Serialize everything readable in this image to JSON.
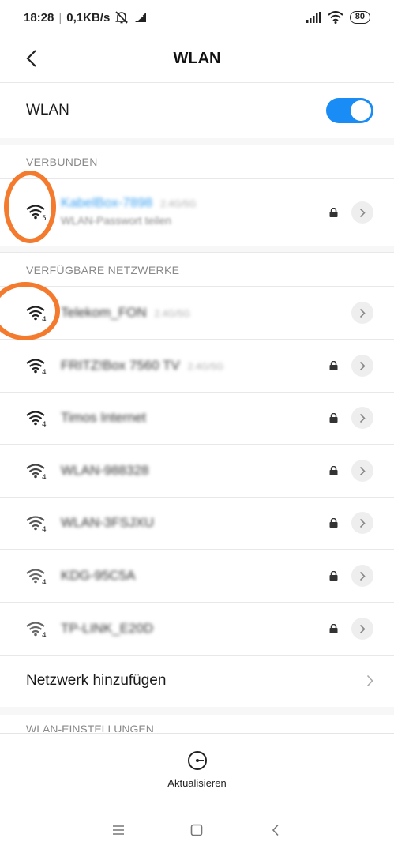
{
  "status_bar": {
    "time": "18:28",
    "network_speed": "0,1KB/s",
    "battery": "80"
  },
  "header": {
    "title": "WLAN"
  },
  "wlan_toggle": {
    "label": "WLAN",
    "enabled": true
  },
  "connected_section": {
    "header": "VERBUNDEN",
    "network": {
      "name": "KabelBox-7898",
      "band": "2.4G/5G",
      "subtitle": "WLAN-Passwort teilen",
      "signal": "5",
      "secured": true
    }
  },
  "available_section": {
    "header": "VERFÜGBARE NETZWERKE",
    "networks": [
      {
        "name": "Telekom_FON",
        "band": "2.4G/5G",
        "signal": "4",
        "secured": false
      },
      {
        "name": "FRITZ!Box 7560 TV",
        "band": "2.4G/5G",
        "signal": "4",
        "secured": true
      },
      {
        "name": "Timos Internet",
        "band": "",
        "signal": "4",
        "secured": true
      },
      {
        "name": "WLAN-988328",
        "band": "",
        "signal": "4",
        "secured": true
      },
      {
        "name": "WLAN-3FSJXU",
        "band": "",
        "signal": "4",
        "secured": true
      },
      {
        "name": "KDG-95C5A",
        "band": "",
        "signal": "4",
        "secured": true
      },
      {
        "name": "TP-LINK_E20D",
        "band": "",
        "signal": "4",
        "secured": true
      }
    ]
  },
  "add_network": {
    "label": "Netzwerk hinzufügen"
  },
  "settings_section": {
    "header": "WLAN-EINSTELLUNGEN"
  },
  "refresh": {
    "label": "Aktualisieren"
  },
  "colors": {
    "accent": "#1a8cf5",
    "connected_text": "#3aa0f0",
    "annotation": "#f47a2e"
  }
}
